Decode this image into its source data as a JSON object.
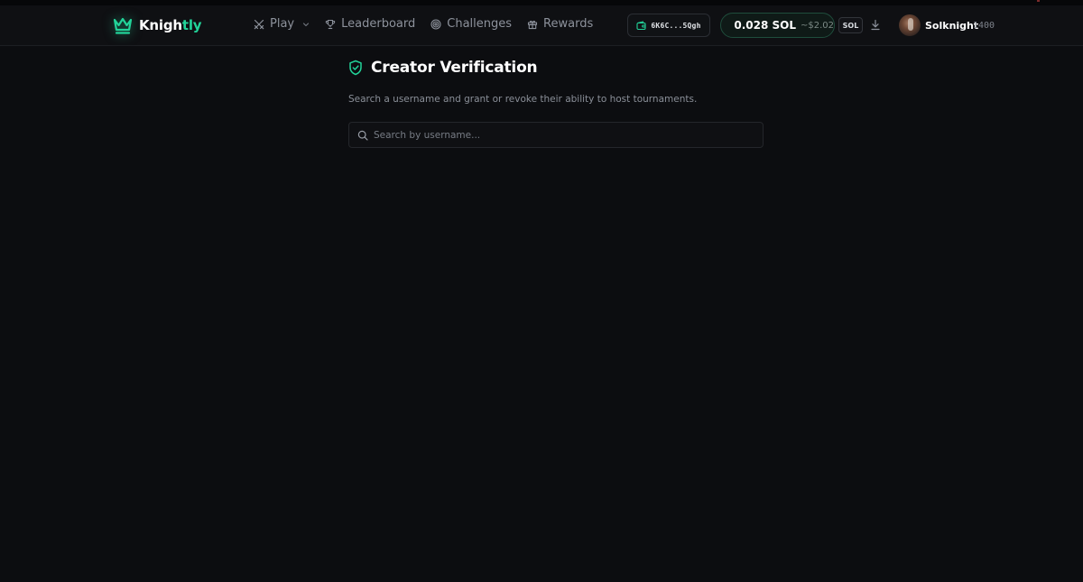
{
  "brand": {
    "name_part1": "Knigh",
    "name_part2": "tly",
    "accent_color": "#22d399"
  },
  "nav": {
    "items": [
      {
        "label": "Play",
        "icon": "crossed-swords-icon",
        "has_dropdown": true
      },
      {
        "label": "Leaderboard",
        "icon": "trophy-icon"
      },
      {
        "label": "Challenges",
        "icon": "target-icon"
      },
      {
        "label": "Rewards",
        "icon": "gift-icon"
      }
    ]
  },
  "wallet": {
    "address_short": "6K6C...5Qgh",
    "icon": "wallet-icon"
  },
  "balance": {
    "amount": "0.028 SOL",
    "usd": "~$2.02",
    "icon": "solana-icon"
  },
  "currency": {
    "label": "SOL"
  },
  "user": {
    "name": "Solknight",
    "rating": "1400"
  },
  "page": {
    "title": "Creator Verification",
    "title_icon": "shield-check-icon",
    "subtitle": "Search a username and grant or revoke their ability to host tournaments.",
    "search_placeholder": "Search by username...",
    "search_value": ""
  }
}
